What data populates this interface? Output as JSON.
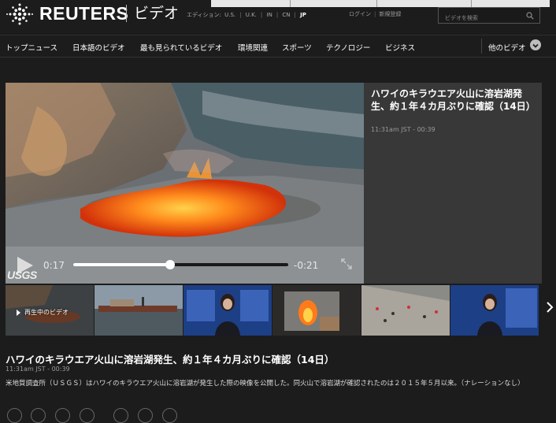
{
  "header": {
    "logo_text": "REUTERS",
    "section_title": "ビデオ",
    "edition_label": "エディション:",
    "editions": [
      "U.S.",
      "U.K.",
      "IN",
      "CN",
      "JP"
    ],
    "active_edition": "JP",
    "login": "ログイン",
    "register": "新規登録",
    "search_placeholder": "ビデオを検索"
  },
  "nav": {
    "items": [
      "トップニュース",
      "日本語のビデオ",
      "最も見られているビデオ",
      "環境関連",
      "スポーツ",
      "テクノロジー",
      "ビジネス"
    ],
    "more_label": "他のビデオ"
  },
  "player": {
    "elapsed": "0:17",
    "remaining": "-0:21",
    "progress": 0.45,
    "source_logo": "USGS"
  },
  "info_panel": {
    "title": "ハワイのキラウエア火山に溶岩湖発生、約１年４カ月ぶりに確認（14日）",
    "meta": "11:31am JST - 00:39"
  },
  "playlist": {
    "now_playing_label": "再生中のビデオ",
    "thumbnails": [
      "lava-lake",
      "harbor-ship",
      "anchor-studio-chart",
      "fire-scene",
      "crowd-street",
      "anchor-nasdaq"
    ]
  },
  "article": {
    "title": "ハワイのキラウエア火山に溶岩湖発生、約１年４カ月ぶりに確認（14日）",
    "meta": "11:31am JST - 00:39",
    "description": "米地質調査所（ＵＳＧＳ）はハワイのキラウエア火山に溶岩湖が発生した際の映像を公開した。同火山で溶岩湖が確認されたのは２０１５年５月以来。（ナレーションなし）"
  },
  "colors": {
    "background": "#1c1c1c",
    "panel": "#383838",
    "lava": "#ff6a10"
  }
}
